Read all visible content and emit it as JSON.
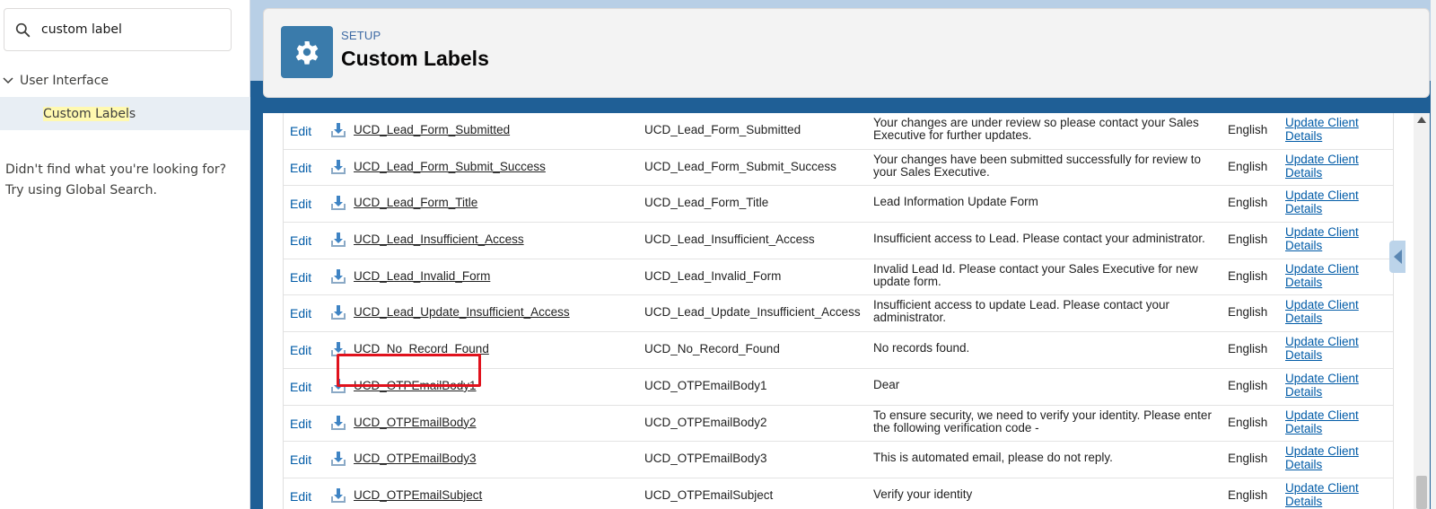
{
  "sidebar": {
    "search_value": "custom label",
    "tree_parent": "User Interface",
    "tree_child_prefix": "Custom Label",
    "tree_child_suffix": "s",
    "not_found_line1": "Didn't find what you're looking for?",
    "not_found_line2": "Try using Global Search."
  },
  "header": {
    "subtitle": "SETUP",
    "title": "Custom Labels",
    "icon": "gear-icon"
  },
  "table": {
    "edit_label": "Edit",
    "language": "English",
    "action_line1": "Update Client",
    "action_line2": "Details",
    "rows": [
      {
        "label": "UCD_Lead_Form_Submitted",
        "name": "UCD_Lead_Form_Submitted",
        "value": "Your changes are under review so please contact your Sales Executive for further updates."
      },
      {
        "label": "UCD_Lead_Form_Submit_Success",
        "name": "UCD_Lead_Form_Submit_Success",
        "value": "Your changes have been submitted successfully for review to your Sales Executive."
      },
      {
        "label": "UCD_Lead_Form_Title",
        "name": "UCD_Lead_Form_Title",
        "value": "Lead Information Update Form"
      },
      {
        "label": "UCD_Lead_Insufficient_Access",
        "name": "UCD_Lead_Insufficient_Access",
        "value": "Insufficient access to Lead. Please contact your administrator."
      },
      {
        "label": "UCD_Lead_Invalid_Form",
        "name": "UCD_Lead_Invalid_Form",
        "value": "Invalid Lead Id. Please contact your Sales Executive for new update form."
      },
      {
        "label": "UCD_Lead_Update_Insufficient_Access",
        "name": "UCD_Lead_Update_Insufficient_Access",
        "value": "Insufficient access to update Lead. Please contact your administrator."
      },
      {
        "label": "UCD_No_Record_Found",
        "name": "UCD_No_Record_Found",
        "value": "No records found."
      },
      {
        "label": "UCD_OTPEmailBody1",
        "name": "UCD_OTPEmailBody1",
        "value": "Dear"
      },
      {
        "label": "UCD_OTPEmailBody2",
        "name": "UCD_OTPEmailBody2",
        "value": "To ensure security, we need to verify your identity. Please enter the following verification code -"
      },
      {
        "label": "UCD_OTPEmailBody3",
        "name": "UCD_OTPEmailBody3",
        "value": "This is automated email, please do not reply."
      },
      {
        "label": "UCD_OTPEmailSubject",
        "name": "UCD_OTPEmailSubject",
        "value": "Verify your identity"
      }
    ]
  }
}
